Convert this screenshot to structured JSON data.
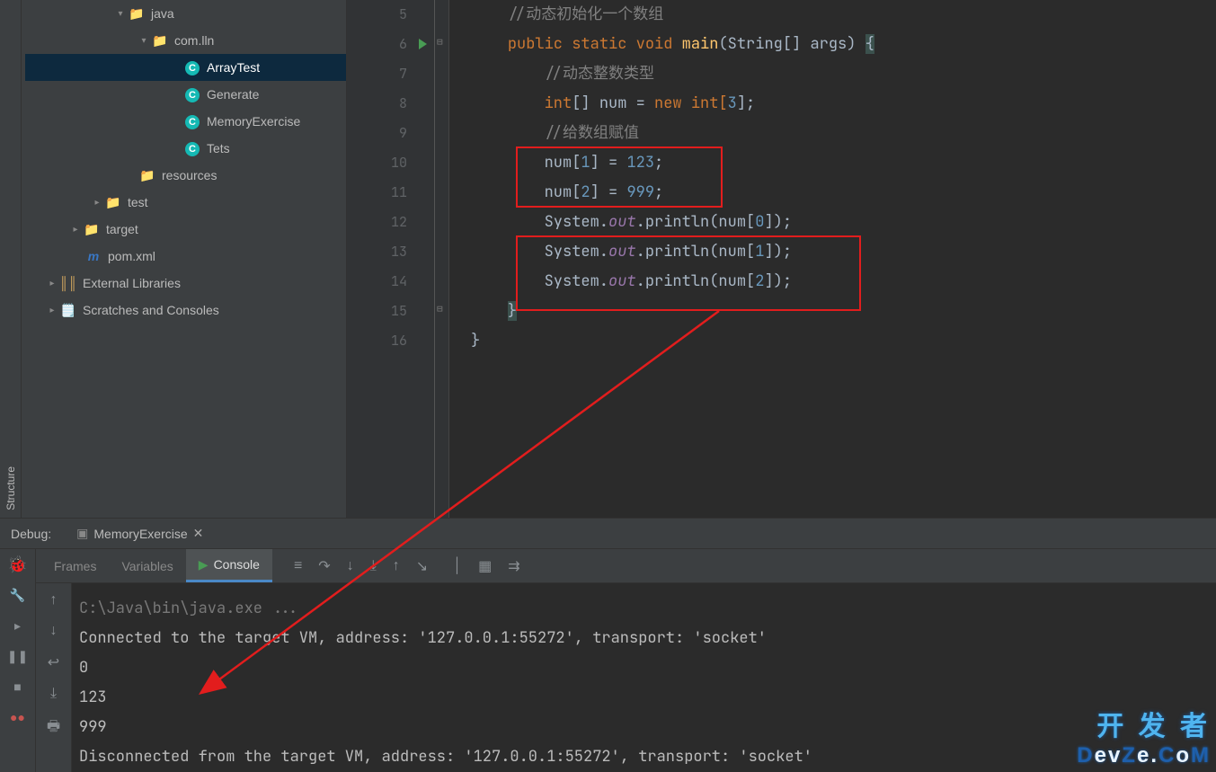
{
  "tree": {
    "java": "java",
    "pkg": "com.lln",
    "files": [
      "ArrayTest",
      "Generate",
      "MemoryExercise",
      "Tets"
    ],
    "resources": "resources",
    "test": "test",
    "target": "target",
    "pom": "pom.xml",
    "ext": "External Libraries",
    "scr": "Scratches and Consoles"
  },
  "code": {
    "l5": "//动态初始化一个数组",
    "l6a": "public",
    "l6b": "static",
    "l6c": "void",
    "l6d": "main",
    "l6e": "(String[] args) ",
    "l6f": "{",
    "l7": "//动态整数类型",
    "l8a": "int",
    "l8b": "[] num = ",
    "l8c": "new",
    "l8d": " int[",
    "l8e": "3",
    "l8f": "];",
    "l9": "//给数组赋值",
    "l10a": "num[",
    "l10b": "1",
    "l10c": "] = ",
    "l10d": "123",
    "l10e": ";",
    "l11a": "num[",
    "l11b": "2",
    "l11c": "] = ",
    "l11d": "999",
    "l11e": ";",
    "l12a": "System.",
    "l12b": "out",
    "l12c": ".println(num[",
    "l12d": "0",
    "l12e": "]);",
    "l13a": "System.",
    "l13b": "out",
    "l13c": ".println(num[",
    "l13d": "1",
    "l13e": "]);",
    "l14a": "System.",
    "l14b": "out",
    "l14c": ".println(num[",
    "l14d": "2",
    "l14e": "]);",
    "l15": "}",
    "l16": "}"
  },
  "gutter": [
    "5",
    "6",
    "7",
    "8",
    "9",
    "10",
    "11",
    "12",
    "13",
    "14",
    "15",
    "16"
  ],
  "debug": {
    "title": "Debug:",
    "tab": "MemoryExercise",
    "tabs": {
      "frames": "Frames",
      "vars": "Variables",
      "console": "Console"
    }
  },
  "console": {
    "l1": "C:\\Java\\bin\\java.exe ...",
    "l2": "Connected to the target VM, address: '127.0.0.1:55272', transport: 'socket'",
    "l3": "0",
    "l4": "123",
    "l5": "999",
    "l6": "Disconnected from the target VM, address: '127.0.0.1:55272', transport: 'socket'"
  },
  "sideTool": "Structure",
  "watermark": {
    "l1": "开 发 者",
    "l2": "DevZe.CoM"
  }
}
